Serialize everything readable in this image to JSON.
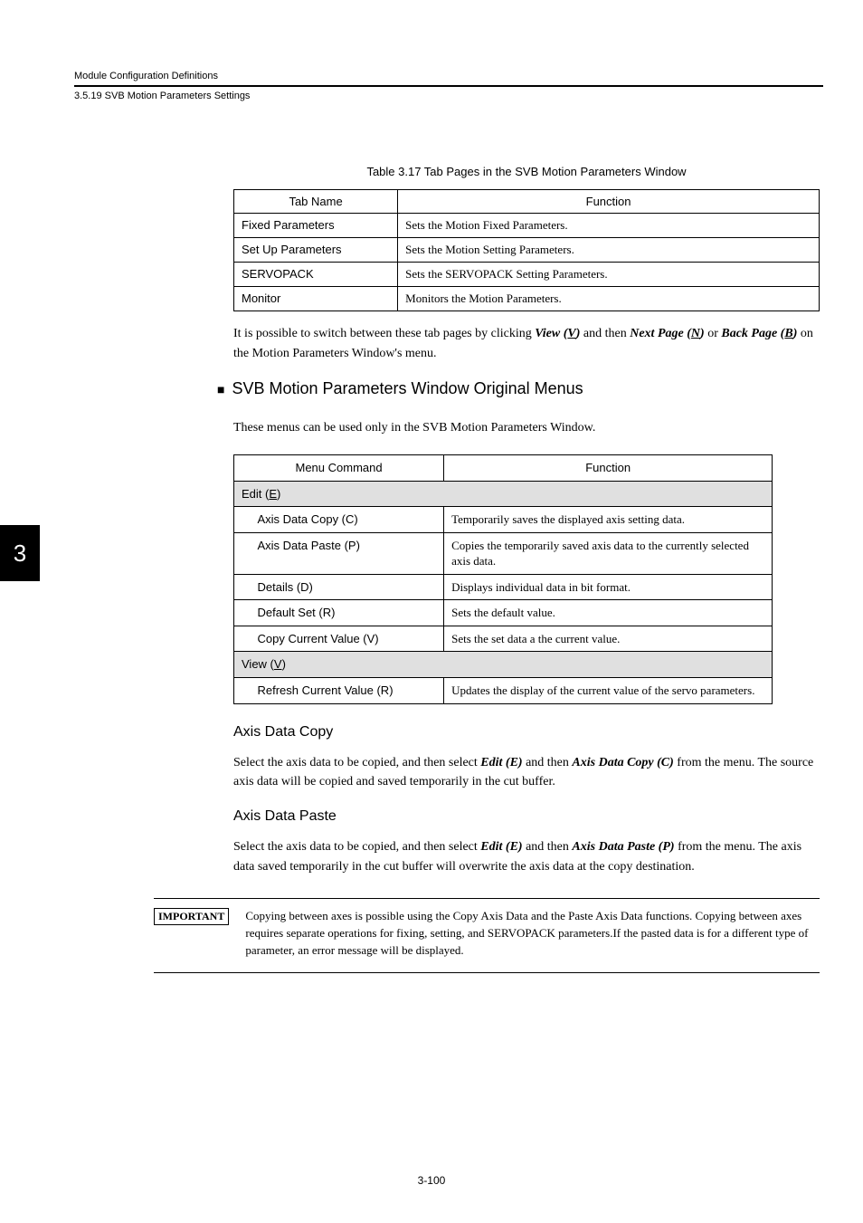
{
  "header": {
    "top": "Module Configuration Definitions",
    "sub": "3.5.19  SVB Motion Parameters Settings"
  },
  "side_tab": "3",
  "table1": {
    "caption": "Table 3.17  Tab Pages in the SVB Motion Parameters Window",
    "col1": "Tab Name",
    "col2": "Function",
    "rows": [
      {
        "c1": "Fixed Parameters",
        "c2": "Sets the Motion Fixed Parameters."
      },
      {
        "c1": "Set Up Parameters",
        "c2": "Sets the Motion Setting Parameters."
      },
      {
        "c1": "SERVOPACK",
        "c2": "Sets the SERVOPACK Setting Parameters."
      },
      {
        "c1": "Monitor",
        "c2": "Monitors the Motion Parameters."
      }
    ]
  },
  "p1_a": "It is possible to switch between these tab pages by clicking ",
  "p1_b": "View (",
  "p1_c": "V",
  "p1_d": ")",
  "p1_e": " and then ",
  "p1_f": "Next Page (",
  "p1_g": "N",
  "p1_h": ")",
  "p1_i": " or ",
  "p1_j": "Back Page (",
  "p1_k": "B",
  "p1_l": ")",
  "p1_m": " on the Motion Parameters Window's menu.",
  "h2": "SVB Motion Parameters Window Original Menus",
  "p2": "These menus can be used only in the SVB Motion Parameters Window.",
  "table2": {
    "col1": "Menu Command",
    "col2": "Function",
    "edit_a": "Edit (",
    "edit_b": "E",
    "edit_c": ")",
    "r1c1": "Axis Data Copy (C)",
    "r1c2": "Temporarily saves the displayed axis setting data.",
    "r2c1": "Axis Data Paste (P)",
    "r2c2": "Copies the temporarily saved axis data to the currently selected axis data.",
    "r3c1": "Details (D)",
    "r3c2": "Displays individual data in bit format.",
    "r4c1": "Default Set (R)",
    "r4c2": "Sets the default value.",
    "r5c1": "Copy Current Value (V)",
    "r5c2": "Sets the set data a the current value.",
    "view_a": "View (",
    "view_b": "V",
    "view_c": ")",
    "r6c1": "Refresh Current Value (R)",
    "r6c2": "Updates the display of the current value of the servo parameters."
  },
  "h3a": "Axis Data Copy",
  "p3_a": "Select the axis data to be copied, and then select ",
  "p3_b": "Edit (E)",
  "p3_c": " and then ",
  "p3_d": "Axis Data Copy (C)",
  "p3_e": " from the menu. The source axis data will be copied and saved temporarily in the cut buffer.",
  "h3b": "Axis Data Paste",
  "p4_a": "Select the axis data to be copied, and then select ",
  "p4_b": "Edit (E)",
  "p4_c": " and then ",
  "p4_d": "Axis Data Paste (P)",
  "p4_e": " from the menu. The axis data saved temporarily in the cut buffer will overwrite the axis data at the copy destination.",
  "important_label": "IMPORTANT",
  "important_text": "Copying between axes is possible using the Copy Axis Data and the Paste Axis Data functions. Copying between axes requires separate operations for fixing, setting, and SERVOPACK parameters.If the pasted data is for a different type of parameter, an error message will be displayed.",
  "page_num": "3-100"
}
